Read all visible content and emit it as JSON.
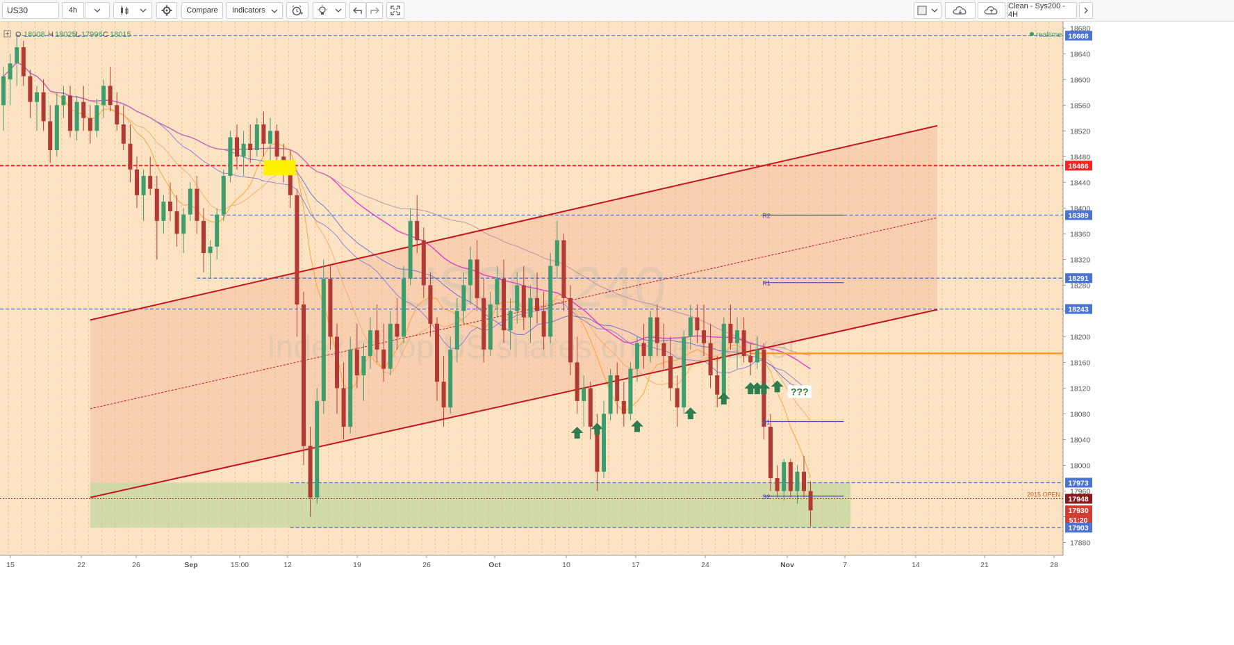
{
  "toolbar": {
    "symbol": "US30",
    "interval": "4h",
    "compare_label": "Compare",
    "indicators_label": "Indicators",
    "layout_label": "Clean - Sys200 - 4H"
  },
  "legend": {
    "o_label": "O",
    "o": "18008",
    "h_label": "H",
    "h": "18025",
    "l_label": "L",
    "l": "17996",
    "c_label": "C",
    "c": "18015",
    "realtime": "realtime"
  },
  "watermark": {
    "symbol": "US30, 240",
    "description": "Index of top US shares on the market"
  },
  "colors": {
    "background": "#fce3c4",
    "up_candle": "#3e9d6c",
    "down_candle": "#b23a32",
    "blue_level": "#4a73d3",
    "red_level": "#ff2020",
    "channel": "#c4161c",
    "orange_level": "#ff9a1e",
    "green_zone": "#c9d9a6",
    "arrow": "#2f7d4e",
    "highlight": "#fff200"
  },
  "annotations": {
    "question": "???",
    "open_2015": "2015 OPEN",
    "pivots": {
      "r2": "R2",
      "r1": "R1",
      "s1": "S1",
      "s2": "S2"
    }
  },
  "chart_data": {
    "type": "candlestick",
    "ylim": [
      17860,
      18690
    ],
    "x_ticks": [
      "15",
      "22",
      "26",
      "Sep",
      "15:00",
      "12",
      "19",
      "26",
      "Oct",
      "10",
      "17",
      "24",
      "Nov",
      "7",
      "14",
      "21",
      "28"
    ],
    "y_ticks": [
      17880,
      17920,
      17960,
      18000,
      18040,
      18080,
      18120,
      18160,
      18200,
      18240,
      18280,
      18320,
      18360,
      18400,
      18440,
      18480,
      18520,
      18560,
      18600,
      18640,
      18680
    ],
    "price_labels": [
      {
        "value": 18668,
        "label": "18668",
        "color": "#4a73d3"
      },
      {
        "value": 18466,
        "label": "18466",
        "color": "#ff2020"
      },
      {
        "value": 18389,
        "label": "18389",
        "color": "#4a73d3"
      },
      {
        "value": 18291,
        "label": "18291",
        "color": "#4a73d3"
      },
      {
        "value": 18243,
        "label": "18243",
        "color": "#4a73d3"
      },
      {
        "value": 17973,
        "label": "17973",
        "color": "#4a73d3"
      },
      {
        "value": 17948,
        "label": "17948",
        "color": "#8b1a1a"
      },
      {
        "value": 17930,
        "label": "17930",
        "color": "#d33c33"
      },
      {
        "value": 17915,
        "label": "51:20",
        "color": "#d33c33"
      },
      {
        "value": 17903,
        "label": "17903",
        "color": "#4a73d3"
      }
    ],
    "horizontal_levels": [
      {
        "value": 18668,
        "color": "#4a73d3"
      },
      {
        "value": 18466,
        "color": "#ff2020"
      },
      {
        "value": 18389,
        "color": "#4a73d3"
      },
      {
        "value": 18291,
        "color": "#4a73d3"
      },
      {
        "value": 18243,
        "color": "#4a73d3"
      },
      {
        "value": 17973,
        "color": "#4a73d3"
      },
      {
        "value": 17903,
        "color": "#4a73d3"
      },
      {
        "value": 18174,
        "color": "#ff9a1e"
      },
      {
        "value": 17948,
        "color": "#8b1a1a"
      }
    ],
    "candles": [
      [
        18560,
        18620,
        18520,
        18605
      ],
      [
        18600,
        18640,
        18560,
        18625
      ],
      [
        18625,
        18670,
        18590,
        18650
      ],
      [
        18650,
        18660,
        18590,
        18605
      ],
      [
        18605,
        18615,
        18540,
        18565
      ],
      [
        18565,
        18590,
        18520,
        18580
      ],
      [
        18580,
        18600,
        18520,
        18535
      ],
      [
        18535,
        18560,
        18470,
        18490
      ],
      [
        18490,
        18580,
        18480,
        18560
      ],
      [
        18560,
        18590,
        18540,
        18575
      ],
      [
        18575,
        18590,
        18510,
        18520
      ],
      [
        18520,
        18575,
        18505,
        18565
      ],
      [
        18565,
        18590,
        18520,
        18540
      ],
      [
        18540,
        18560,
        18500,
        18520
      ],
      [
        18520,
        18570,
        18510,
        18560
      ],
      [
        18560,
        18600,
        18540,
        18590
      ],
      [
        18590,
        18620,
        18550,
        18560
      ],
      [
        18560,
        18580,
        18520,
        18530
      ],
      [
        18530,
        18560,
        18490,
        18500
      ],
      [
        18500,
        18530,
        18440,
        18460
      ],
      [
        18460,
        18480,
        18400,
        18420
      ],
      [
        18420,
        18460,
        18380,
        18450
      ],
      [
        18450,
        18480,
        18420,
        18430
      ],
      [
        18430,
        18450,
        18320,
        18380
      ],
      [
        18380,
        18420,
        18360,
        18410
      ],
      [
        18410,
        18440,
        18380,
        18395
      ],
      [
        18395,
        18420,
        18340,
        18360
      ],
      [
        18360,
        18400,
        18330,
        18390
      ],
      [
        18390,
        18440,
        18380,
        18430
      ],
      [
        18430,
        18450,
        18360,
        18380
      ],
      [
        18380,
        18400,
        18300,
        18330
      ],
      [
        18330,
        18350,
        18290,
        18340
      ],
      [
        18340,
        18400,
        18320,
        18390
      ],
      [
        18390,
        18460,
        18380,
        18450
      ],
      [
        18450,
        18520,
        18440,
        18510
      ],
      [
        18510,
        18530,
        18460,
        18480
      ],
      [
        18480,
        18520,
        18450,
        18500
      ],
      [
        18500,
        18530,
        18470,
        18490
      ],
      [
        18490,
        18540,
        18480,
        18530
      ],
      [
        18530,
        18550,
        18480,
        18500
      ],
      [
        18500,
        18540,
        18470,
        18520
      ],
      [
        18520,
        18530,
        18460,
        18480
      ],
      [
        18480,
        18500,
        18440,
        18470
      ],
      [
        18470,
        18490,
        18400,
        18420
      ],
      [
        18420,
        18430,
        18200,
        18250
      ],
      [
        18250,
        18270,
        18000,
        18030
      ],
      [
        18030,
        18060,
        17920,
        17950
      ],
      [
        17950,
        18120,
        17940,
        18100
      ],
      [
        18100,
        18320,
        18080,
        18290
      ],
      [
        18290,
        18310,
        18180,
        18200
      ],
      [
        18200,
        18220,
        18080,
        18120
      ],
      [
        18120,
        18160,
        18040,
        18060
      ],
      [
        18060,
        18200,
        18050,
        18180
      ],
      [
        18180,
        18220,
        18120,
        18140
      ],
      [
        18140,
        18190,
        18100,
        18170
      ],
      [
        18170,
        18230,
        18150,
        18210
      ],
      [
        18210,
        18250,
        18160,
        18180
      ],
      [
        18180,
        18220,
        18130,
        18150
      ],
      [
        18150,
        18240,
        18140,
        18220
      ],
      [
        18220,
        18260,
        18180,
        18200
      ],
      [
        18200,
        18310,
        18190,
        18290
      ],
      [
        18290,
        18400,
        18280,
        18380
      ],
      [
        18380,
        18420,
        18330,
        18350
      ],
      [
        18350,
        18370,
        18260,
        18280
      ],
      [
        18280,
        18300,
        18200,
        18220
      ],
      [
        18220,
        18230,
        18100,
        18130
      ],
      [
        18130,
        18170,
        18060,
        18090
      ],
      [
        18090,
        18200,
        18080,
        18180
      ],
      [
        18180,
        18260,
        18160,
        18240
      ],
      [
        18240,
        18300,
        18220,
        18280
      ],
      [
        18280,
        18340,
        18250,
        18320
      ],
      [
        18320,
        18350,
        18240,
        18260
      ],
      [
        18260,
        18290,
        18160,
        18180
      ],
      [
        18180,
        18270,
        18170,
        18250
      ],
      [
        18250,
        18310,
        18230,
        18290
      ],
      [
        18290,
        18320,
        18190,
        18210
      ],
      [
        18210,
        18260,
        18180,
        18240
      ],
      [
        18240,
        18300,
        18220,
        18280
      ],
      [
        18280,
        18310,
        18210,
        18230
      ],
      [
        18230,
        18280,
        18190,
        18260
      ],
      [
        18260,
        18300,
        18220,
        18240
      ],
      [
        18240,
        18270,
        18180,
        18200
      ],
      [
        18200,
        18330,
        18190,
        18310
      ],
      [
        18310,
        18380,
        18290,
        18350
      ],
      [
        18350,
        18360,
        18240,
        18260
      ],
      [
        18260,
        18280,
        18140,
        18160
      ],
      [
        18160,
        18200,
        18080,
        18100
      ],
      [
        18100,
        18140,
        18060,
        18120
      ],
      [
        18120,
        18130,
        18040,
        18060
      ],
      [
        18060,
        18080,
        17960,
        17990
      ],
      [
        17990,
        18100,
        17980,
        18080
      ],
      [
        18080,
        18150,
        18070,
        18140
      ],
      [
        18140,
        18160,
        18080,
        18100
      ],
      [
        18100,
        18130,
        18060,
        18080
      ],
      [
        18080,
        18160,
        18070,
        18150
      ],
      [
        18150,
        18200,
        18130,
        18190
      ],
      [
        18190,
        18220,
        18150,
        18170
      ],
      [
        18170,
        18240,
        18160,
        18230
      ],
      [
        18230,
        18250,
        18170,
        18190
      ],
      [
        18190,
        18220,
        18150,
        18170
      ],
      [
        18170,
        18200,
        18100,
        18120
      ],
      [
        18120,
        18140,
        18060,
        18090
      ],
      [
        18090,
        18210,
        18080,
        18200
      ],
      [
        18200,
        18250,
        18180,
        18230
      ],
      [
        18230,
        18250,
        18190,
        18210
      ],
      [
        18210,
        18250,
        18170,
        18190
      ],
      [
        18190,
        18220,
        18120,
        18140
      ],
      [
        18140,
        18170,
        18090,
        18110
      ],
      [
        18110,
        18230,
        18100,
        18220
      ],
      [
        18220,
        18250,
        18180,
        18190
      ],
      [
        18190,
        18230,
        18150,
        18210
      ],
      [
        18210,
        18230,
        18160,
        18170
      ],
      [
        18170,
        18190,
        18140,
        18160
      ],
      [
        18160,
        18200,
        18150,
        18180
      ],
      [
        18180,
        18190,
        18040,
        18060
      ],
      [
        18060,
        18080,
        17960,
        17980
      ],
      [
        17980,
        18000,
        17950,
        17960
      ],
      [
        17960,
        18010,
        17945,
        18005
      ],
      [
        18005,
        18010,
        17950,
        17960
      ],
      [
        17960,
        18000,
        17940,
        17990
      ],
      [
        17990,
        18015,
        17950,
        17960
      ],
      [
        17960,
        17975,
        17905,
        17930
      ]
    ],
    "channel_upper": {
      "from": [
        13,
        18226
      ],
      "to": [
        140,
        18528
      ]
    },
    "channel_lower": {
      "from": [
        13,
        17950
      ],
      "to": [
        140,
        18242
      ]
    },
    "channel_mid": {
      "from": [
        13,
        18088
      ],
      "to": [
        140,
        18385
      ]
    }
  }
}
